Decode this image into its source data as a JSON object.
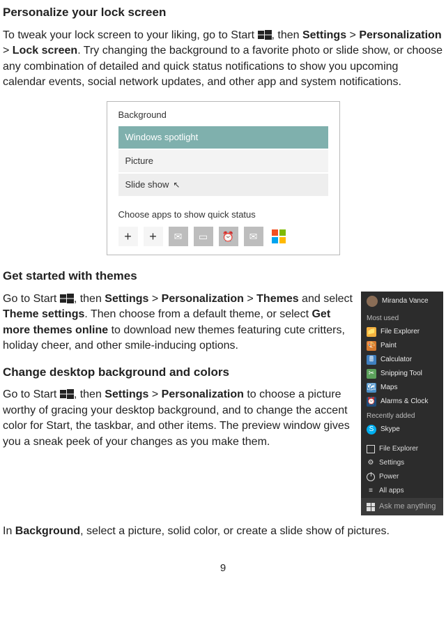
{
  "page_number": "9",
  "section1": {
    "heading": "Personalize your lock screen",
    "p_a": "To tweak your lock screen to your liking, go to Start ",
    "p_b": ", then ",
    "settings": "Settings",
    "sp1": "  > ",
    "personalization": "Personalization",
    "sp2": " > ",
    "lockscreen": "Lock screen",
    "p_c": ". Try changing the background to a favorite photo or slide show, or choose any combination of detailed and quick status notifications to show you upcoming calendar events, social network updates, and other app and system notifications."
  },
  "lock_figure": {
    "background_label": "Background",
    "opt_spotlight": "Windows spotlight",
    "opt_picture": "Picture",
    "opt_slideshow": "Slide show",
    "apps_label": "Choose apps to show quick status"
  },
  "section2": {
    "heading": "Get started with themes",
    "p_a": "Go to Start ",
    "p_b": ", then ",
    "settings": "Settings",
    "sp1": " > ",
    "personalization": "Personalization",
    "sp2": " > ",
    "themes": "Themes",
    "p_c": " and select ",
    "theme_settings": "Theme settings",
    "p_d": ". Then choose from a default theme, or select ",
    "get_more": "Get more themes online",
    "p_e": " to download new themes featuring cute critters, holiday cheer, and other smile-inducing options."
  },
  "section3": {
    "heading": "Change desktop background and colors",
    "p_a": "Go to Start ",
    "p_b": ", then ",
    "settings": "Settings",
    "sp1": " > ",
    "personalization": "Personalization",
    "p_c": " to choose a picture worthy of gracing your desktop background, and to change the accent color for Start, the taskbar, and other items. The preview window gives you a sneak peek of your changes as you make them."
  },
  "section4": {
    "p_a": "In ",
    "background": "Background",
    "p_b": ", select a picture, solid color, or create a slide show of pictures."
  },
  "startmenu": {
    "user": "Miranda Vance",
    "header_most": "Most used",
    "items_most": [
      "File Explorer",
      "Paint",
      "Calculator",
      "Snipping Tool",
      "Maps",
      "Alarms & Clock"
    ],
    "header_recent": "Recently added",
    "items_recent": [
      "Skype"
    ],
    "lower": [
      "File Explorer",
      "Settings",
      "Power",
      "All apps"
    ],
    "search": "Ask me anything"
  }
}
